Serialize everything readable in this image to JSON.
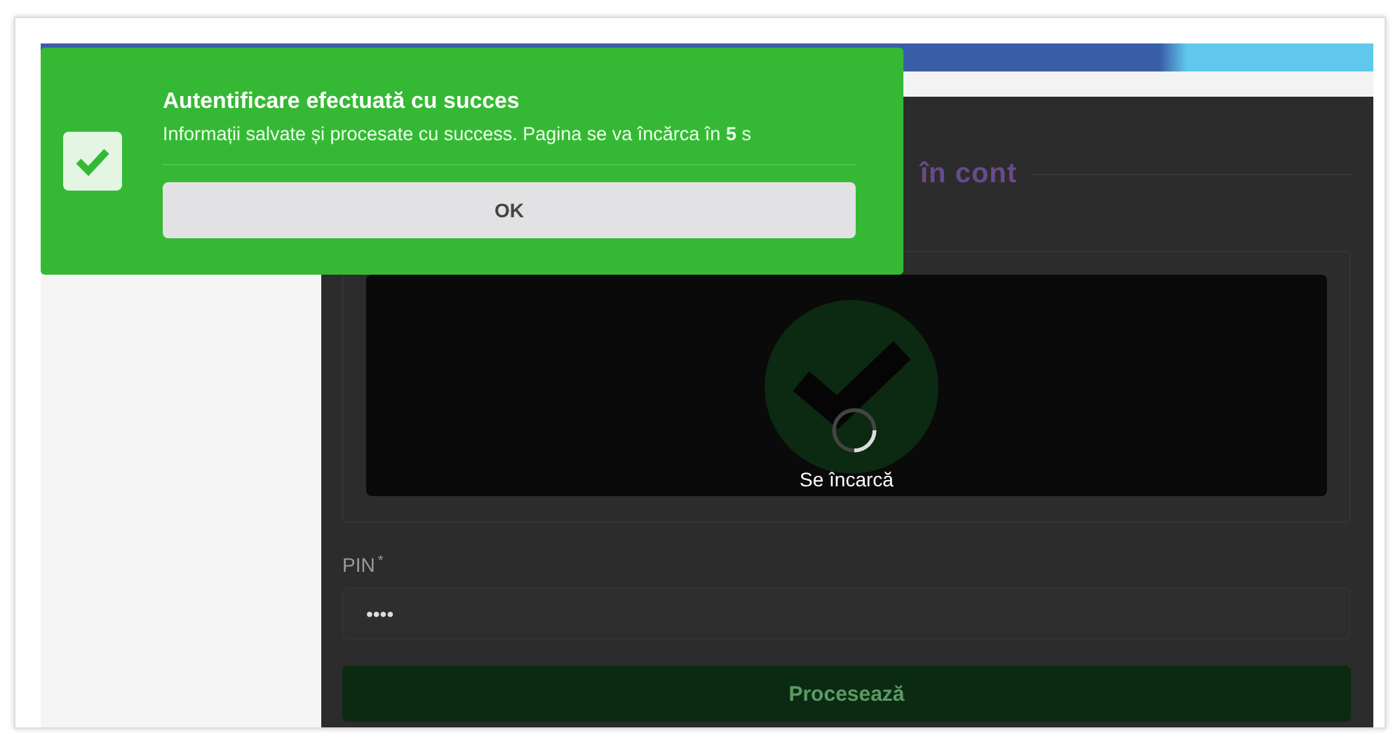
{
  "toast": {
    "kind": "success",
    "title": "Autentificare efectuată cu succes",
    "message": "Informații salvate și procesate cu success. Pagina se va încărca în **5** s",
    "button": "OK"
  },
  "page": {
    "heading": "în cont",
    "loading_text": "Se încarcă",
    "pin": {
      "label": "PIN",
      "required_mark": "*",
      "value": "••••"
    },
    "submit": "Procesează"
  }
}
